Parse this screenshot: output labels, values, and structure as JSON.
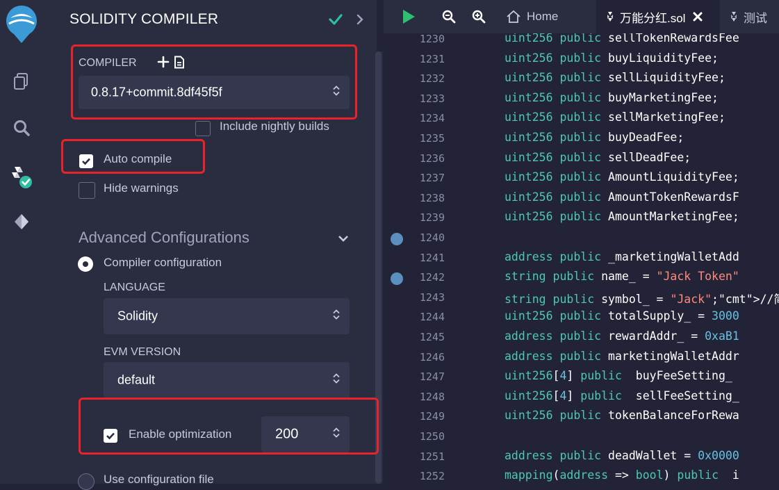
{
  "panel": {
    "title": "SOLIDITY COMPILER",
    "compiler_label": "COMPILER",
    "compiler_version": "0.8.17+commit.8df45f5f",
    "nightly_label": "Include nightly builds",
    "auto_compile_label": "Auto compile",
    "hide_warnings_label": "Hide warnings",
    "advanced_label": "Advanced Configurations",
    "compiler_config_label": "Compiler configuration",
    "language_label": "LANGUAGE",
    "language_value": "Solidity",
    "evm_label": "EVM VERSION",
    "evm_value": "default",
    "optimization_label": "Enable optimization",
    "optimization_runs": "200",
    "use_config_label": "Use configuration file"
  },
  "tabs": {
    "home": "Home",
    "file1": "万能分红.sol",
    "file2": "测试"
  },
  "editor": {
    "lines": [
      {
        "n": "1230",
        "code": "uint256 public sellTokenRewardsFee"
      },
      {
        "n": "1231",
        "code": "uint256 public buyLiquidityFee;"
      },
      {
        "n": "1232",
        "code": "uint256 public sellLiquidityFee;"
      },
      {
        "n": "1233",
        "code": "uint256 public buyMarketingFee;"
      },
      {
        "n": "1234",
        "code": "uint256 public sellMarketingFee;"
      },
      {
        "n": "1235",
        "code": "uint256 public buyDeadFee;"
      },
      {
        "n": "1236",
        "code": "uint256 public sellDeadFee;"
      },
      {
        "n": "1237",
        "code": "uint256 public AmountLiquidityFee;"
      },
      {
        "n": "1238",
        "code": "uint256 public AmountTokenRewardsF"
      },
      {
        "n": "1239",
        "code": "uint256 public AmountMarketingFee;"
      },
      {
        "n": "1240",
        "code": ""
      },
      {
        "n": "1241",
        "code": "address public _marketingWalletAdd"
      },
      {
        "n": "1242",
        "code": "string public name_ = \"Jack Token\""
      },
      {
        "n": "1243",
        "code": "string public symbol_ = \"Jack\";//简"
      },
      {
        "n": "1244",
        "code": "uint256 public totalSupply_ = 3000"
      },
      {
        "n": "1245",
        "code": "address public rewardAddr_ = 0xaB1"
      },
      {
        "n": "1246",
        "code": "address public marketingWalletAddr"
      },
      {
        "n": "1247",
        "code": "uint256[4] public  buyFeeSetting_"
      },
      {
        "n": "1248",
        "code": "uint256[4] public  sellFeeSetting_"
      },
      {
        "n": "1249",
        "code": "uint256 public tokenBalanceForRewa"
      },
      {
        "n": "1250",
        "code": ""
      },
      {
        "n": "1251",
        "code": "address public deadWallet = 0x0000"
      },
      {
        "n": "1252",
        "code": "mapping(address => bool) public  i"
      }
    ],
    "breakpoints": [
      "1240",
      "1242"
    ]
  },
  "colors": {
    "accent": "#2fbfa0",
    "annotation": "#e8242a",
    "play": "#2fbf71"
  }
}
